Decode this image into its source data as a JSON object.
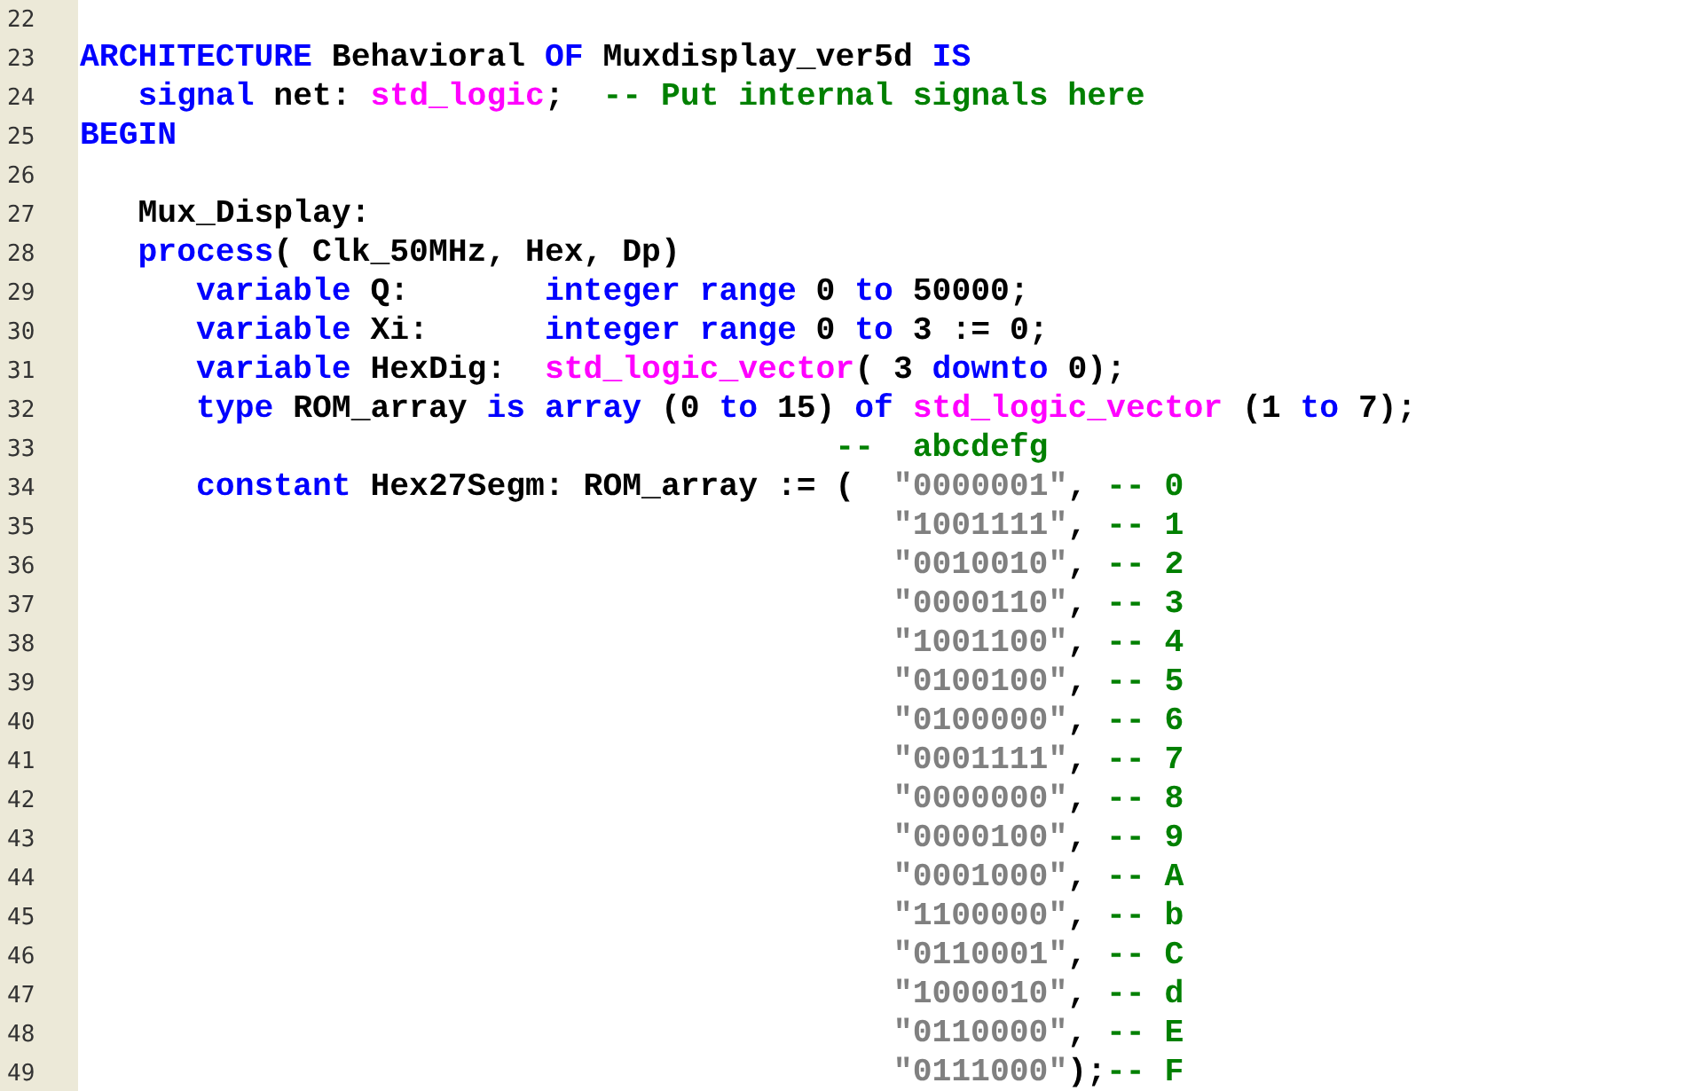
{
  "editor": {
    "lines": [
      {
        "number": "22"
      },
      {
        "number": "23",
        "tokens": [
          {
            "kind": "keyword",
            "text": "ARCHITECTURE"
          },
          {
            "kind": "plain",
            "text": " Behavioral "
          },
          {
            "kind": "keyword",
            "text": "OF"
          },
          {
            "kind": "plain",
            "text": " Muxdisplay_ver5d "
          },
          {
            "kind": "keyword",
            "text": "IS"
          }
        ]
      },
      {
        "number": "24",
        "tokens": [
          {
            "kind": "keyword",
            "text": "   signal"
          },
          {
            "kind": "plain",
            "text": " net: "
          },
          {
            "kind": "type",
            "text": "std_logic"
          },
          {
            "kind": "plain",
            "text": ";  "
          },
          {
            "kind": "comment",
            "text": "-- Put internal signals here"
          }
        ]
      },
      {
        "number": "25",
        "tokens": [
          {
            "kind": "keyword",
            "text": "BEGIN"
          }
        ]
      },
      {
        "number": "26"
      },
      {
        "number": "27",
        "tokens": [
          {
            "kind": "plain",
            "text": "   Mux_Display:"
          }
        ]
      },
      {
        "number": "28",
        "tokens": [
          {
            "kind": "keyword",
            "text": "   process"
          },
          {
            "kind": "plain",
            "text": "( Clk_50MHz, Hex, Dp)"
          }
        ]
      },
      {
        "number": "29",
        "tokens": [
          {
            "kind": "keyword",
            "text": "      variable"
          },
          {
            "kind": "plain",
            "text": " Q:       "
          },
          {
            "kind": "keyword",
            "text": "integer range"
          },
          {
            "kind": "plain",
            "text": " 0 "
          },
          {
            "kind": "keyword",
            "text": "to"
          },
          {
            "kind": "plain",
            "text": " 50000;"
          }
        ]
      },
      {
        "number": "30",
        "tokens": [
          {
            "kind": "keyword",
            "text": "      variable"
          },
          {
            "kind": "plain",
            "text": " Xi:      "
          },
          {
            "kind": "keyword",
            "text": "integer range"
          },
          {
            "kind": "plain",
            "text": " 0 "
          },
          {
            "kind": "keyword",
            "text": "to"
          },
          {
            "kind": "plain",
            "text": " 3 := 0;"
          }
        ]
      },
      {
        "number": "31",
        "tokens": [
          {
            "kind": "keyword",
            "text": "      variable"
          },
          {
            "kind": "plain",
            "text": " HexDig:  "
          },
          {
            "kind": "type",
            "text": "std_logic_vector"
          },
          {
            "kind": "plain",
            "text": "( 3 "
          },
          {
            "kind": "keyword",
            "text": "downto"
          },
          {
            "kind": "plain",
            "text": " 0);"
          }
        ]
      },
      {
        "number": "32",
        "tokens": [
          {
            "kind": "keyword",
            "text": "      type"
          },
          {
            "kind": "plain",
            "text": " ROM_array "
          },
          {
            "kind": "keyword",
            "text": "is array"
          },
          {
            "kind": "plain",
            "text": " (0 "
          },
          {
            "kind": "keyword",
            "text": "to"
          },
          {
            "kind": "plain",
            "text": " 15) "
          },
          {
            "kind": "keyword",
            "text": "of "
          },
          {
            "kind": "type",
            "text": "std_logic_vector"
          },
          {
            "kind": "plain",
            "text": " (1 "
          },
          {
            "kind": "keyword",
            "text": "to"
          },
          {
            "kind": "plain",
            "text": " 7);"
          }
        ]
      },
      {
        "number": "33",
        "tokens": [
          {
            "kind": "comment",
            "text": "                                       --  abcdefg"
          }
        ]
      },
      {
        "number": "34",
        "tokens": [
          {
            "kind": "keyword",
            "text": "      constant"
          },
          {
            "kind": "plain",
            "text": " Hex27Segm: ROM_array := (  "
          },
          {
            "kind": "string",
            "text": "\"0000001\""
          },
          {
            "kind": "plain",
            "text": ", "
          },
          {
            "kind": "comment",
            "text": "-- 0"
          }
        ]
      },
      {
        "number": "35",
        "tokens": [
          {
            "kind": "string",
            "text": "                                          \"1001111\""
          },
          {
            "kind": "plain",
            "text": ", "
          },
          {
            "kind": "comment",
            "text": "-- 1"
          }
        ]
      },
      {
        "number": "36",
        "tokens": [
          {
            "kind": "string",
            "text": "                                          \"0010010\""
          },
          {
            "kind": "plain",
            "text": ", "
          },
          {
            "kind": "comment",
            "text": "-- 2"
          }
        ]
      },
      {
        "number": "37",
        "tokens": [
          {
            "kind": "string",
            "text": "                                          \"0000110\""
          },
          {
            "kind": "plain",
            "text": ", "
          },
          {
            "kind": "comment",
            "text": "-- 3"
          }
        ]
      },
      {
        "number": "38",
        "tokens": [
          {
            "kind": "string",
            "text": "                                          \"1001100\""
          },
          {
            "kind": "plain",
            "text": ", "
          },
          {
            "kind": "comment",
            "text": "-- 4"
          }
        ]
      },
      {
        "number": "39",
        "tokens": [
          {
            "kind": "string",
            "text": "                                          \"0100100\""
          },
          {
            "kind": "plain",
            "text": ", "
          },
          {
            "kind": "comment",
            "text": "-- 5"
          }
        ]
      },
      {
        "number": "40",
        "tokens": [
          {
            "kind": "string",
            "text": "                                          \"0100000\""
          },
          {
            "kind": "plain",
            "text": ", "
          },
          {
            "kind": "comment",
            "text": "-- 6"
          }
        ]
      },
      {
        "number": "41",
        "tokens": [
          {
            "kind": "string",
            "text": "                                          \"0001111\""
          },
          {
            "kind": "plain",
            "text": ", "
          },
          {
            "kind": "comment",
            "text": "-- 7"
          }
        ]
      },
      {
        "number": "42",
        "tokens": [
          {
            "kind": "string",
            "text": "                                          \"0000000\""
          },
          {
            "kind": "plain",
            "text": ", "
          },
          {
            "kind": "comment",
            "text": "-- 8"
          }
        ]
      },
      {
        "number": "43",
        "tokens": [
          {
            "kind": "string",
            "text": "                                          \"0000100\""
          },
          {
            "kind": "plain",
            "text": ", "
          },
          {
            "kind": "comment",
            "text": "-- 9"
          }
        ]
      },
      {
        "number": "44",
        "tokens": [
          {
            "kind": "string",
            "text": "                                          \"0001000\""
          },
          {
            "kind": "plain",
            "text": ", "
          },
          {
            "kind": "comment",
            "text": "-- A"
          }
        ]
      },
      {
        "number": "45",
        "tokens": [
          {
            "kind": "string",
            "text": "                                          \"1100000\""
          },
          {
            "kind": "plain",
            "text": ", "
          },
          {
            "kind": "comment",
            "text": "-- b"
          }
        ]
      },
      {
        "number": "46",
        "tokens": [
          {
            "kind": "string",
            "text": "                                          \"0110001\""
          },
          {
            "kind": "plain",
            "text": ", "
          },
          {
            "kind": "comment",
            "text": "-- C"
          }
        ]
      },
      {
        "number": "47",
        "tokens": [
          {
            "kind": "string",
            "text": "                                          \"1000010\""
          },
          {
            "kind": "plain",
            "text": ", "
          },
          {
            "kind": "comment",
            "text": "-- d"
          }
        ]
      },
      {
        "number": "48",
        "tokens": [
          {
            "kind": "string",
            "text": "                                          \"0110000\""
          },
          {
            "kind": "plain",
            "text": ", "
          },
          {
            "kind": "comment",
            "text": "-- E"
          }
        ]
      },
      {
        "number": "49",
        "tokens": [
          {
            "kind": "string",
            "text": "                                          \"0111000\""
          },
          {
            "kind": "plain",
            "text": ");"
          },
          {
            "kind": "comment",
            "text": "-- F"
          }
        ]
      }
    ]
  }
}
